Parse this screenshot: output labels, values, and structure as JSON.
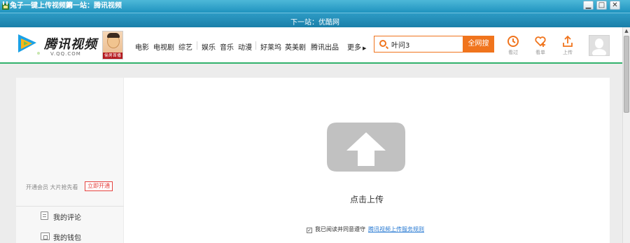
{
  "window": {
    "title": "兔子一键上传视频网",
    "subtitle": "第一站：腾讯视频",
    "controls": {
      "minimize": "▁",
      "maximize": "□",
      "close": "✕"
    }
  },
  "next_bar": {
    "text": "下一站：优酷网"
  },
  "header": {
    "logo": {
      "title": "腾讯视频",
      "domain": "V.QQ.COM",
      "icon": "tencent-video-play-logo"
    },
    "promo_label": "偷男首播",
    "nav": [
      "电影",
      "电视剧",
      "综艺",
      "娱乐",
      "音乐",
      "动漫",
      "好莱坞",
      "英美剧",
      "腾讯出品",
      "更多"
    ],
    "search": {
      "value": "叶问3",
      "button": "全网搜",
      "icon": "search-icon"
    },
    "tools": [
      {
        "label": "看过",
        "icon": "history-icon"
      },
      {
        "label": "看单",
        "icon": "heart-plus-icon"
      },
      {
        "label": "上传",
        "icon": "upload-icon"
      }
    ],
    "avatar_icon": "default-avatar-icon"
  },
  "sidebar": {
    "vip_text": "开通会员 大片抢先看",
    "vip_button": "立即开通",
    "items": [
      {
        "label": "我的评论",
        "icon": "comments-icon"
      },
      {
        "label": "我的钱包",
        "icon": "wallet-icon"
      }
    ]
  },
  "main": {
    "upload_label": "点击上传",
    "agree_text": "我已阅读并同意遵守",
    "agree_link": "腾讯视频上传服务规则",
    "agree_checked": true
  },
  "colors": {
    "accent": "#f0741d",
    "brand_green": "#32b16c",
    "titlebar": "#1f93bf"
  }
}
